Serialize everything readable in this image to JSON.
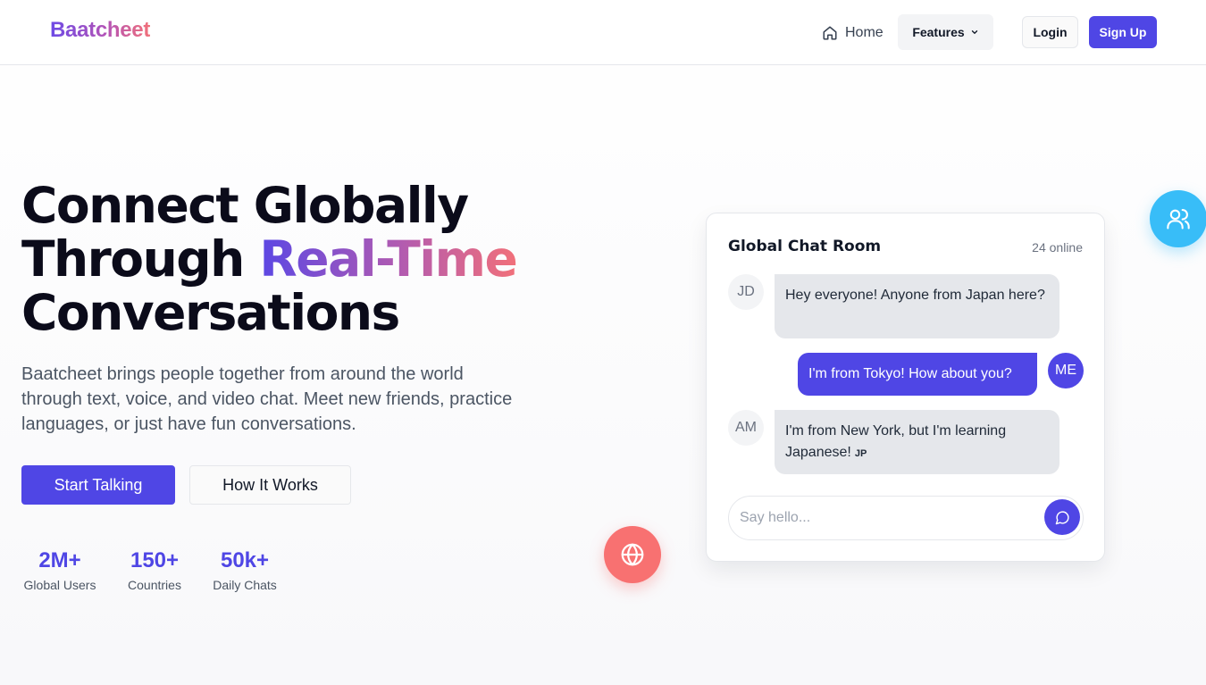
{
  "brand": {
    "logo": "Baatcheet"
  },
  "nav": {
    "home": "Home",
    "features": "Features",
    "login": "Login",
    "signup": "Sign Up"
  },
  "hero": {
    "title_line1": "Connect Globally",
    "title_line2_plain": "Through ",
    "title_line2_highlight": "Real-Time",
    "title_line3": "Conversations",
    "description": "Baatcheet brings people together from around the world through text, voice, and video chat. Meet new friends, practice languages, or just have fun conversations.",
    "primary_cta": "Start Talking",
    "secondary_cta": "How It Works"
  },
  "stats": [
    {
      "value": "2M+",
      "label": "Global Users"
    },
    {
      "value": "150+",
      "label": "Countries"
    },
    {
      "value": "50k+",
      "label": "Daily Chats"
    }
  ],
  "chat": {
    "title": "Global Chat Room",
    "online": "24 online",
    "messages": [
      {
        "initials": "JD",
        "text": "Hey everyone! Anyone from Japan here?",
        "flag": ""
      },
      {
        "initials": "ME",
        "text": "I'm from Tokyo! How about you?",
        "flag": ""
      },
      {
        "initials": "AM",
        "text": "I'm from New York, but I'm learning Japanese!",
        "flag": "JP"
      }
    ],
    "input_placeholder": "Say hello..."
  },
  "icons": {
    "home": "home-icon",
    "features_chevron": "chevron-down-icon",
    "send": "message-circle-icon",
    "globe": "globe-icon",
    "users": "users-icon"
  },
  "colors": {
    "primary": "#4f46e5",
    "globe_badge": "#f87171",
    "users_badge": "#38bdf8",
    "gradient_start": "#5b47e4",
    "gradient_end": "#f1707a"
  }
}
